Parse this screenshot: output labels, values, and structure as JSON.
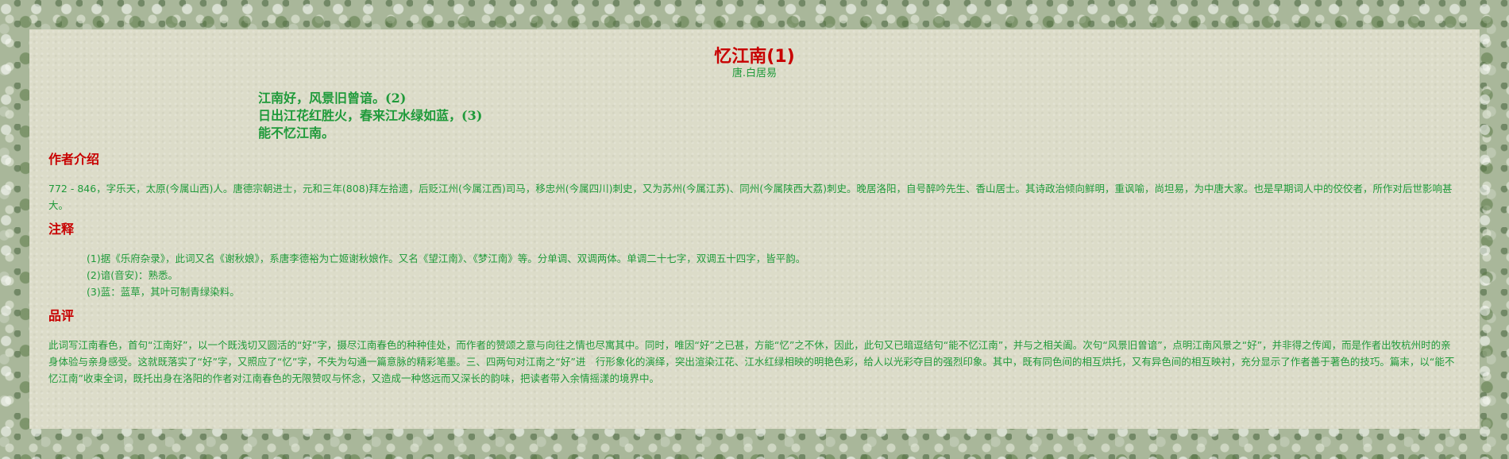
{
  "poem": {
    "title": "忆江南(1)",
    "author": "唐.白居易",
    "lines": [
      "江南好，风景旧曾谙。(2)",
      "日出江花红胜火，春来江水绿如蓝，(3)",
      "能不忆江南。"
    ]
  },
  "author_section": {
    "heading": "作者介绍",
    "text": "772 - 846，字乐天，太原(今属山西)人。唐德宗朝进士，元和三年(808)拜左拾遗，后贬江州(今属江西)司马，移忠州(今属四川)刺史，又为苏州(今属江苏)、同州(今属陕西大荔)刺史。晚居洛阳，自号醉吟先生、香山居士。其诗政治倾向鲜明，重讽喻，尚坦易，为中唐大家。也是早期词人中的佼佼者，所作对后世影响甚大。"
  },
  "notes_section": {
    "heading": "注释",
    "items": [
      "(1)据《乐府杂录》，此词又名《谢秋娘》，系唐李德裕为亡姬谢秋娘作。又名《望江南》、《梦江南》等。分单调、双调两体。单调二十七字，双调五十四字，皆平韵。",
      "(2)谙(音安)：熟悉。",
      "(3)蓝：蓝草，其叶可制青绿染料。"
    ]
  },
  "review_section": {
    "heading": "品评",
    "text": "此词写江南春色，首句“江南好”，以一个既浅切又圆活的“好”字，摄尽江南春色的种种佳处，而作者的赞颂之意与向往之情也尽寓其中。同时，唯因“好”之已甚，方能“忆”之不休，因此，此句又已暗逗结句“能不忆江南”，并与之相关阖。次句“风景旧曾谙”，点明江南风景之“好”，并非得之传闻，而是作者出牧杭州时的亲身体验与亲身感受。这就既落实了“好”字，又照应了“忆”字，不失为勾通一篇意脉的精彩笔墨。三、四两句对江南之“好”进　行形象化的演绎，突出渲染江花、江水红绿相映的明艳色彩，给人以光彩夺目的强烈印象。其中，既有同色间的相互烘托，又有异色间的相互映衬，充分显示了作者善于著色的技巧。篇末，以“能不忆江南”收束全词，既托出身在洛阳的作者对江南春色的无限赞叹与怀念，又造成一种悠远而又深长的韵味，把读者带入余情摇漾的境界中。"
  }
}
